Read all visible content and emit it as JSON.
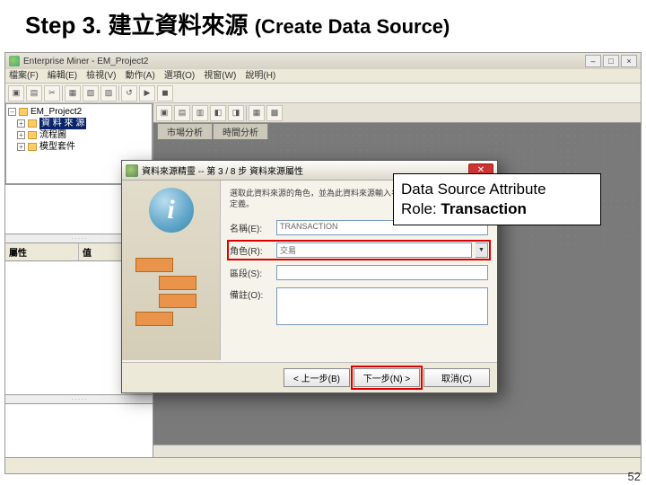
{
  "header": {
    "step": "Step 3.",
    "zh": "建立資料來源",
    "en": "(Create Data Source)"
  },
  "app": {
    "title": "Enterprise Miner - EM_Project2",
    "menus": [
      "檔案(F)",
      "編輯(E)",
      "檢視(V)",
      "動作(A)",
      "選項(O)",
      "視窗(W)",
      "說明(H)"
    ],
    "tree": {
      "root": "EM_Project2",
      "items": [
        "資 料 來 源",
        "流程圖",
        "模型套件"
      ]
    },
    "prop": {
      "col1": "屬性",
      "col2": "值"
    },
    "canvas_tabs": [
      "市場分析",
      "時間分析"
    ]
  },
  "wizard": {
    "title": "資料來源精靈 -- 第 3 / 8 步 資料來源屬性",
    "desc": "選取此資料來源的角色，並為此資料來源輸入名稱和描述以完成資料來源定義。",
    "name_label": "名稱(E):",
    "name_value": "TRANSACTION",
    "role_label": "角色(R):",
    "role_value": "交易",
    "seg_label": "區段(S):",
    "seg_value": "",
    "notes_label": "備註(O):",
    "notes_value": "",
    "buttons": {
      "back": "< 上一步(B)",
      "next": "下一步(N) >",
      "cancel": "取消(C)"
    }
  },
  "callout": {
    "line1": "Data Source Attribute",
    "line2a": "Role: ",
    "line2b": "Transaction"
  },
  "page": "52"
}
